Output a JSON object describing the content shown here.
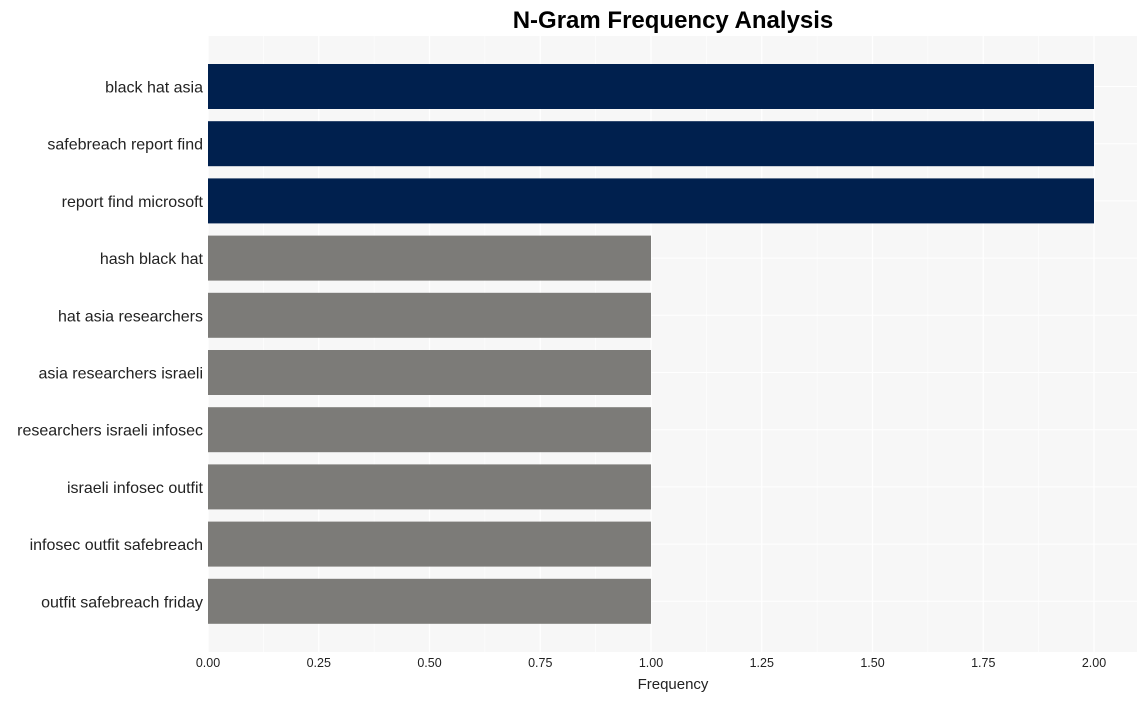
{
  "chart_data": {
    "type": "bar",
    "orientation": "horizontal",
    "title": "N-Gram Frequency Analysis",
    "xlabel": "Frequency",
    "ylabel": "",
    "xlim": [
      0,
      2.1
    ],
    "x_ticks": [
      "0.00",
      "0.25",
      "0.50",
      "0.75",
      "1.00",
      "1.25",
      "1.50",
      "1.75",
      "2.00"
    ],
    "x_tick_values": [
      0,
      0.25,
      0.5,
      0.75,
      1.0,
      1.25,
      1.5,
      1.75,
      2.0
    ],
    "grid": true,
    "legend": "none",
    "categories": [
      "black hat asia",
      "safebreach report find",
      "report find microsoft",
      "hash black hat",
      "hat asia researchers",
      "asia researchers israeli",
      "researchers israeli infosec",
      "israeli infosec outfit",
      "infosec outfit safebreach",
      "outfit safebreach friday"
    ],
    "values": [
      2,
      2,
      2,
      1,
      1,
      1,
      1,
      1,
      1,
      1
    ],
    "colors": {
      "highlight": "#00204e",
      "default": "#7c7b78",
      "panel_background": "#f7f7f7",
      "gridline": "#ffffff"
    }
  }
}
